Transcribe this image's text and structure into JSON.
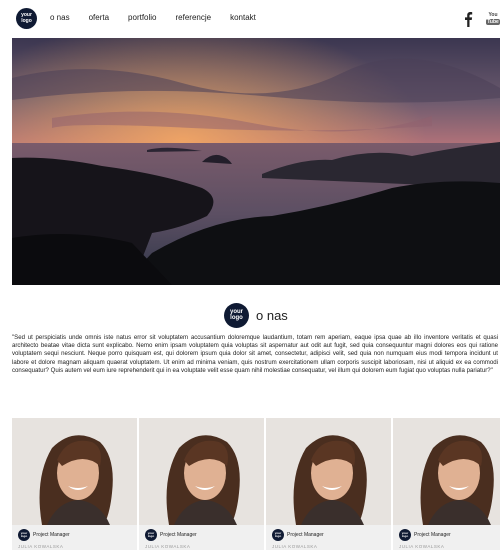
{
  "header": {
    "logo_line1": "your",
    "logo_line2": "logo",
    "nav": [
      "o nas",
      "oferta",
      "portfolio",
      "referencje",
      "kontakt"
    ],
    "youtube_you": "You",
    "youtube_tube": "Tube"
  },
  "hero": {
    "icon": "sunset-landscape-image"
  },
  "about": {
    "logo_line1": "your",
    "logo_line2": "logo",
    "title": "o nas",
    "text": "\"Sed ut perspiciatis unde omnis iste natus error sit voluptatem accusantium doloremque laudantium, totam rem aperiam, eaque ipsa quae ab illo inventore veritatis et quasi architecto beatae vitae dicta sunt explicabo. Nemo enim ipsam voluptatem quia voluptas sit aspernatur aut odit aut fugit, sed quia consequuntur magni dolores eos qui ratione voluptatem sequi nesciunt. Neque porro quisquam est, qui dolorem ipsum quia dolor sit amet, consectetur, adipisci velit, sed quia non numquam eius modi tempora incidunt ut labore et dolore magnam aliquam quaerat voluptatem. Ut enim ad minima veniam, quis nostrum exercitationem ullam corporis suscipit laboriosam, nisi ut aliquid ex ea commodi consequatur? Quis autem vel eum iure reprehenderit qui in ea voluptate velit esse quam nihil molestiae consequatur, vel illum qui dolorem eum fugiat quo voluptas nulla pariatur?\""
  },
  "team": [
    {
      "logo_line1": "your",
      "logo_line2": "logo",
      "role": "Project Manager",
      "name": "JULIA KOWALSKA"
    },
    {
      "logo_line1": "your",
      "logo_line2": "logo",
      "role": "Project Manager",
      "name": "JULIA KOWALSKA"
    },
    {
      "logo_line1": "your",
      "logo_line2": "logo",
      "role": "Project Manager",
      "name": "JULIA KOWALSKA"
    },
    {
      "logo_line1": "your",
      "logo_line2": "logo",
      "role": "Project Manager",
      "name": "JULIA KOWALSKA"
    }
  ],
  "colors": {
    "logo_bg": "#0f1a33",
    "card_bg": "#f0f0f0"
  }
}
